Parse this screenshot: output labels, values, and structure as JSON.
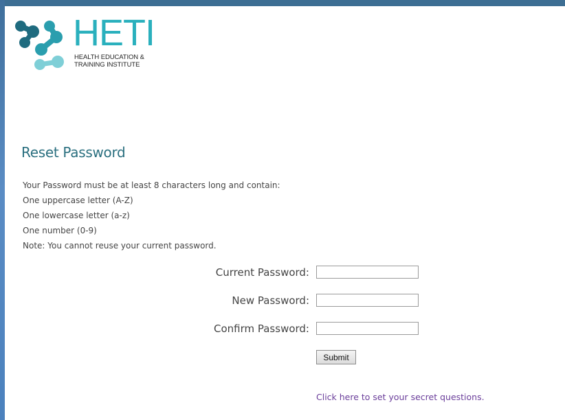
{
  "brand": {
    "name": "HETI",
    "subtitle_line1": "HEALTH EDUCATION &",
    "subtitle_line2": "TRAINING INSTITUTE",
    "color": "#2ab0bd",
    "icon": "heti-molecule-logo"
  },
  "page": {
    "title": "Reset Password",
    "rules": [
      "Your Password must be at least 8 characters long and contain:",
      "One uppercase letter (A-Z)",
      "One lowercase letter (a-z)",
      "One number (0-9)",
      "Note: You cannot reuse your current password."
    ]
  },
  "form": {
    "current_label": "Current Password:",
    "current_value": "",
    "new_label": "New Password:",
    "new_value": "",
    "confirm_label": "Confirm Password:",
    "confirm_value": "",
    "submit_label": "Submit"
  },
  "links": {
    "secret_questions": "Click here to set your secret questions."
  },
  "colors": {
    "title": "#2a6f7f",
    "link": "#6a3d9a",
    "left_bar": "#4b81bd",
    "top_bar": "#3d6e93"
  }
}
